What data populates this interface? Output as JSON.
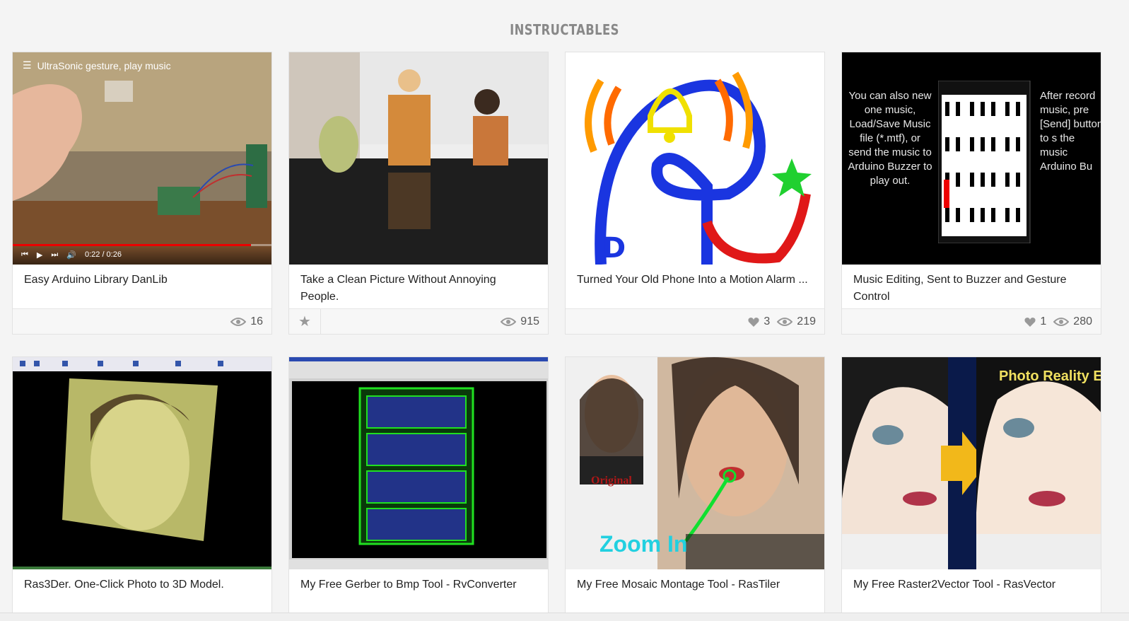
{
  "section": {
    "title": "INSTRUCTABLES"
  },
  "cards": [
    {
      "title": "Easy Arduino Library DanLib",
      "views": "16",
      "video": {
        "title": "UltraSonic gesture, play music",
        "time": "0:22 / 0:26",
        "progress": 0.92
      }
    },
    {
      "title": "Take a Clean Picture Without Annoying People.",
      "views": "915"
    },
    {
      "title": "Turned Your Old Phone Into a Motion Alarm ...",
      "likes": "3",
      "views": "219"
    },
    {
      "title": "Music Editing, Sent to Buzzer and Gesture Control",
      "likes": "1",
      "views": "280",
      "image_text_left": "You can also new one music, Load/Save Music file (*.mtf), or send the music to Arduino Buzzer to play out.",
      "image_text_right": "After record music, pre [Send] button to s the music Arduino Bu"
    },
    {
      "title": "Ras3Der. One-Click Photo to 3D Model."
    },
    {
      "title": "My Free Gerber to Bmp Tool - RvConverter"
    },
    {
      "title": "My Free Mosaic Montage Tool - RasTiler",
      "image_text_original": "Original",
      "image_text_zoom": "Zoom In"
    },
    {
      "title": "My Free Raster2Vector Tool - RasVector",
      "image_text_banner": "Photo Reality E"
    }
  ],
  "colors": {
    "background": "#f4f4f4",
    "card": "#ffffff",
    "heading": "#888888",
    "icon": "#999999"
  }
}
